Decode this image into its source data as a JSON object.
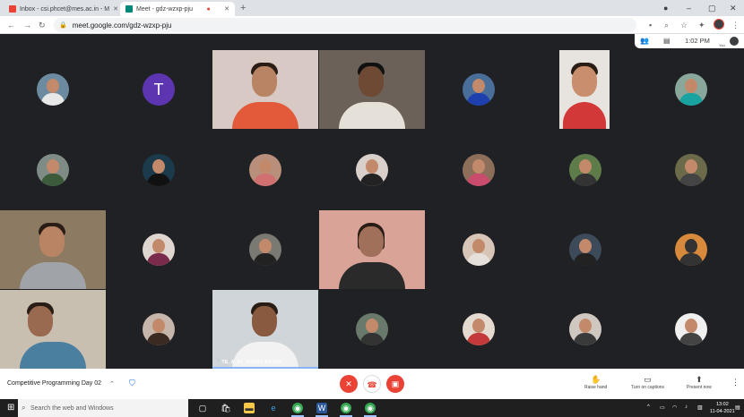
{
  "browser": {
    "tabs": [
      {
        "title": "Inbox - csi.phcet@mes.ac.in - M",
        "active": false
      },
      {
        "title": "Meet - gdz-wzxp-pju",
        "active": true
      }
    ],
    "new_tab_icon": "+",
    "url": "meet.google.com/gdz-wzxp-pju"
  },
  "meet_toolbar": {
    "time": "1:02 PM",
    "you_label": "You"
  },
  "participants": {
    "letter_avatar": "T",
    "highlighted_name": "TE_A_61_VISHAL RAJAK"
  },
  "bottom_bar": {
    "meeting_name": "Competitive Programming Day 02",
    "raise_hand": "Raise hand",
    "captions": "Turn on captions",
    "present": "Present now"
  },
  "taskbar": {
    "search_placeholder": "Search the web and Windows",
    "clock_time": "13:02",
    "clock_date": "11-04-2021"
  },
  "colors": {
    "accent": "#8ab4f8",
    "end_call": "#ea4335",
    "letter_avatar": "#5e35b1"
  }
}
